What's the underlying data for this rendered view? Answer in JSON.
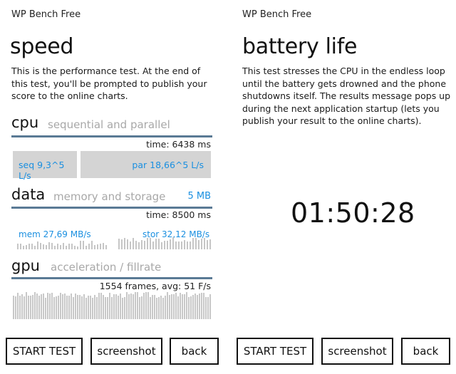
{
  "left": {
    "app_name": "WP Bench Free",
    "title": "speed",
    "description": "This is the performance test. At the end of this test, you'll be prompted to publish your score to the online charts.",
    "cpu": {
      "title": "cpu",
      "subtitle": "sequential and parallel",
      "time": "time: 6438 ms",
      "seq_label": "seq 9,3^5 L/s",
      "par_label": "par 18,66^5 L/s"
    },
    "data": {
      "title": "data",
      "subtitle": "memory and storage",
      "size": "5 MB",
      "time": "time: 8500 ms",
      "mem_label": "mem 27,69 MB/s",
      "stor_label": "stor 32,12 MB/s"
    },
    "gpu": {
      "title": "gpu",
      "subtitle": "acceleration / fillrate",
      "frames": "1554 frames, avg: 51 F/s"
    },
    "buttons": {
      "start": "START TEST",
      "screenshot": "screenshot",
      "back": "back"
    }
  },
  "right": {
    "app_name": "WP Bench Free",
    "title": "battery life",
    "description": "This test stresses the CPU in the endless loop until the battery gets drowned and the phone shutdowns itself. The results message pops up during the next application startup (lets you publish your result to the online charts).",
    "timer": "01:50:28",
    "buttons": {
      "start": "START TEST",
      "screenshot": "screenshot",
      "back": "back"
    }
  },
  "colors": {
    "accent": "#1a8fe0",
    "divider": "#5a7a95",
    "bar_fill": "#d4d4d4"
  },
  "icons": []
}
